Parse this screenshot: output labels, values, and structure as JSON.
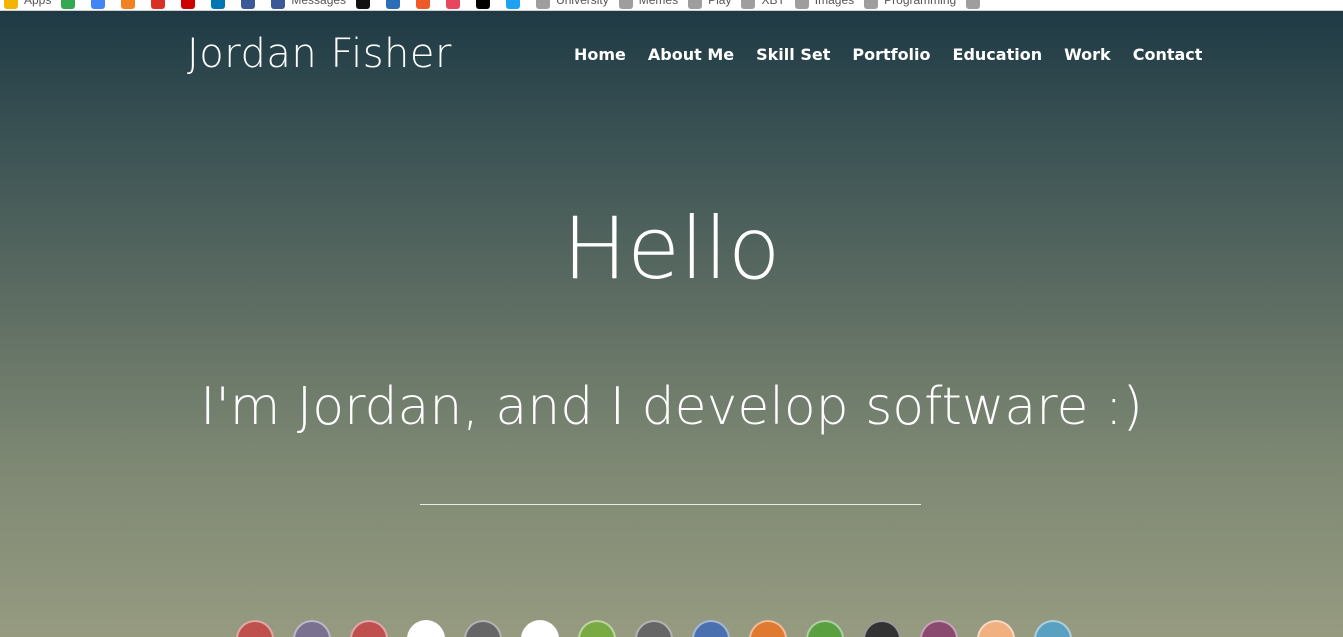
{
  "bookmarks": [
    {
      "label": "Apps",
      "color": "#f4b400"
    },
    {
      "label": "",
      "color": "#34a853"
    },
    {
      "label": "",
      "color": "#4285f4"
    },
    {
      "label": "",
      "color": "#f48024"
    },
    {
      "label": "",
      "color": "#d93025"
    },
    {
      "label": "",
      "color": "#cc0000"
    },
    {
      "label": "",
      "color": "#0077b5"
    },
    {
      "label": "",
      "color": "#3b5998"
    },
    {
      "label": "Messages",
      "color": "#3b5998"
    },
    {
      "label": "",
      "color": "#111111"
    },
    {
      "label": "",
      "color": "#2d6db5"
    },
    {
      "label": "",
      "color": "#f05a28"
    },
    {
      "label": "",
      "color": "#e8465e"
    },
    {
      "label": "",
      "color": "#000000"
    },
    {
      "label": "",
      "color": "#1da1f2"
    },
    {
      "label": "University",
      "color": "#9e9e9e"
    },
    {
      "label": "Memes",
      "color": "#9e9e9e"
    },
    {
      "label": "Play",
      "color": "#9e9e9e"
    },
    {
      "label": "XBT",
      "color": "#9e9e9e"
    },
    {
      "label": "Images",
      "color": "#9e9e9e"
    },
    {
      "label": "Programming",
      "color": "#9e9e9e"
    },
    {
      "label": "",
      "color": "#9e9e9e"
    }
  ],
  "site": {
    "brand": "Jordan Fisher",
    "nav": [
      "Home",
      "About Me",
      "Skill Set",
      "Portfolio",
      "Education",
      "Work",
      "Contact"
    ]
  },
  "hero": {
    "heading": "Hello",
    "tagline": "I'm Jordan, and I develop software :)"
  },
  "skill_circles": [
    "#c0504d",
    "#7a7090",
    "#c05050",
    "#ffffff",
    "#666666",
    "#ffffff",
    "#7aaa44",
    "#666666",
    "#4a70b0",
    "#e07a30",
    "#5aa040",
    "#333333",
    "#8a4a70",
    "#f0b080",
    "#5aa0c0"
  ]
}
